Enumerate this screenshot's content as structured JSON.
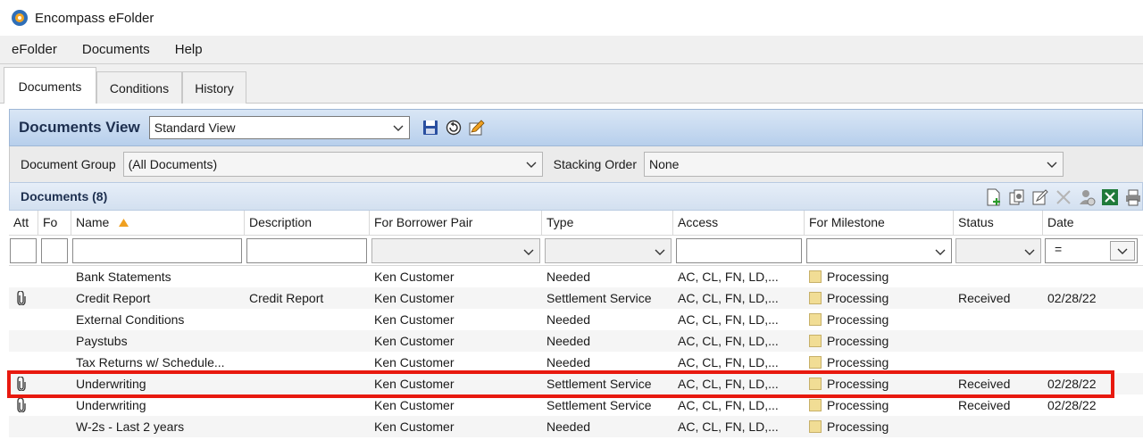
{
  "window": {
    "title": "Encompass eFolder"
  },
  "menu": [
    "eFolder",
    "Documents",
    "Help"
  ],
  "tabs": [
    {
      "label": "Documents",
      "active": true
    },
    {
      "label": "Conditions",
      "active": false
    },
    {
      "label": "History",
      "active": false
    }
  ],
  "documents_view": {
    "title": "Documents View",
    "view_value": "Standard View",
    "icons": [
      "save-icon",
      "reset-icon",
      "edit-view-icon"
    ]
  },
  "group_bar": {
    "group_label": "Document Group",
    "group_value": "(All Documents)",
    "stacking_label": "Stacking Order",
    "stacking_value": "None"
  },
  "documents_panel": {
    "title": "Documents (8)",
    "tools": [
      "add-document-icon",
      "duplicate-icon",
      "edit-icon",
      "delete-icon",
      "request-icon",
      "excel-export-icon",
      "print-icon"
    ]
  },
  "columns": [
    "Att",
    "Fo",
    "Name",
    "Description",
    "For Borrower Pair",
    "Type",
    "Access",
    "For Milestone",
    "Status",
    "Date"
  ],
  "filter": {
    "date_operator": "="
  },
  "rows": [
    {
      "att": false,
      "name": "Bank Statements",
      "description": "",
      "borrower": "Ken Customer",
      "type": "Needed",
      "access": "AC, CL, FN, LD,...",
      "milestone": "Processing",
      "status": "",
      "date": ""
    },
    {
      "att": true,
      "name": "Credit Report",
      "description": "Credit Report",
      "borrower": "Ken Customer",
      "type": "Settlement Service",
      "access": "AC, CL, FN, LD,...",
      "milestone": "Processing",
      "status": "Received",
      "date": "02/28/22"
    },
    {
      "att": false,
      "name": "External Conditions",
      "description": "",
      "borrower": "Ken Customer",
      "type": "Needed",
      "access": "AC, CL, FN, LD,...",
      "milestone": "Processing",
      "status": "",
      "date": ""
    },
    {
      "att": false,
      "name": "Paystubs",
      "description": "",
      "borrower": "Ken Customer",
      "type": "Needed",
      "access": "AC, CL, FN, LD,...",
      "milestone": "Processing",
      "status": "",
      "date": ""
    },
    {
      "att": false,
      "name": "Tax Returns w/ Schedule...",
      "description": "",
      "borrower": "Ken Customer",
      "type": "Needed",
      "access": "AC, CL, FN, LD,...",
      "milestone": "Processing",
      "status": "",
      "date": ""
    },
    {
      "att": true,
      "name": "Underwriting",
      "description": "",
      "borrower": "Ken Customer",
      "type": "Settlement Service",
      "access": "AC, CL, FN, LD,...",
      "milestone": "Processing",
      "status": "Received",
      "date": "02/28/22"
    },
    {
      "att": true,
      "name": "Underwriting",
      "description": "",
      "borrower": "Ken Customer",
      "type": "Settlement Service",
      "access": "AC, CL, FN, LD,...",
      "milestone": "Processing",
      "status": "Received",
      "date": "02/28/22"
    },
    {
      "att": false,
      "name": "W-2s - Last 2 years",
      "description": "",
      "borrower": "Ken Customer",
      "type": "Needed",
      "access": "AC, CL, FN, LD,...",
      "milestone": "Processing",
      "status": "",
      "date": ""
    }
  ],
  "colors": {
    "highlight": "#e8190f",
    "milestone_swatch": "#f1dd95",
    "header_blue": "#b7cfec"
  }
}
